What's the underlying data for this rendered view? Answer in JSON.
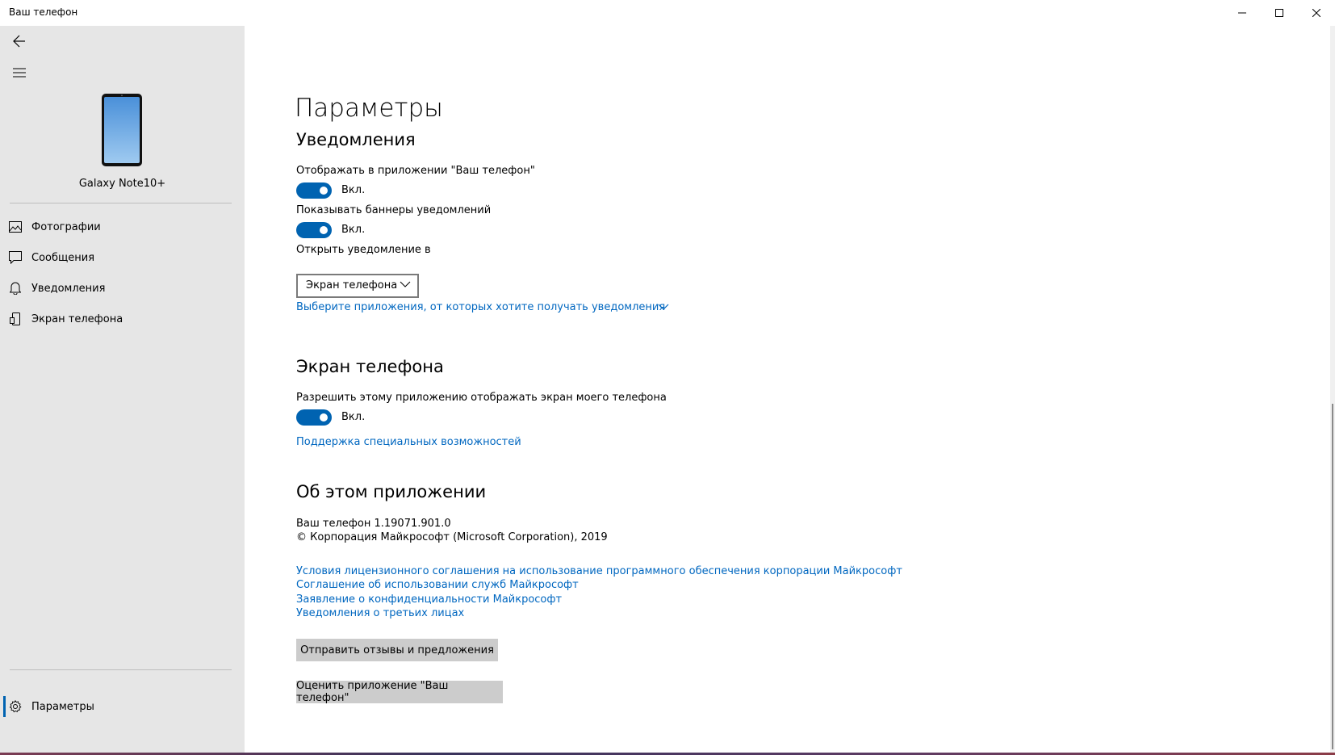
{
  "window": {
    "title": "Ваш телефон",
    "controls": {
      "minimize_icon": "minimize-icon",
      "maximize_icon": "maximize-icon",
      "close_icon": "close-icon"
    }
  },
  "sidebar": {
    "device_name": "Galaxy Note10+",
    "nav": [
      {
        "label": "Фотографии",
        "icon": "photos-icon"
      },
      {
        "label": "Сообщения",
        "icon": "messages-icon"
      },
      {
        "label": "Уведомления",
        "icon": "bell-icon"
      },
      {
        "label": "Экран телефона",
        "icon": "phone-screen-icon"
      }
    ],
    "settings_label": "Параметры"
  },
  "main": {
    "page_title": "Параметры",
    "notifications": {
      "title": "Уведомления",
      "show_in_app_label": "Отображать в приложении \"Ваш телефон\"",
      "show_in_app_state": "Вкл.",
      "show_banners_label": "Показывать баннеры уведомлений",
      "show_banners_state": "Вкл.",
      "open_in_label": "Открыть уведомление в",
      "open_in_value": "Экран телефона",
      "choose_apps_link": "Выберите приложения, от которых хотите получать уведомления"
    },
    "phone_screen": {
      "title": "Экран телефона",
      "allow_label": "Разрешить этому приложению отображать экран моего телефона",
      "allow_state": "Вкл.",
      "accessibility_link": "Поддержка специальных возможностей"
    },
    "about": {
      "title": "Об этом приложении",
      "version": "Ваш телефон 1.19071.901.0",
      "copyright": "© Корпорация Майкрософт (Microsoft Corporation), 2019",
      "links": [
        "Условия лицензионного соглашения на использование программного обеспечения корпорации Майкрософт",
        "Соглашение об использовании служб Майкрософт",
        "Заявление о конфиденциальности Майкрософт",
        "Уведомления о третьих лицах"
      ],
      "feedback_button": "Отправить отзывы и предложения",
      "rate_button": "Оценить приложение \"Ваш телефон\""
    }
  },
  "colors": {
    "accent": "#0063b1",
    "link": "#0067c0",
    "sidebar_bg": "#e6e6e6",
    "button_bg": "#cccccc"
  }
}
